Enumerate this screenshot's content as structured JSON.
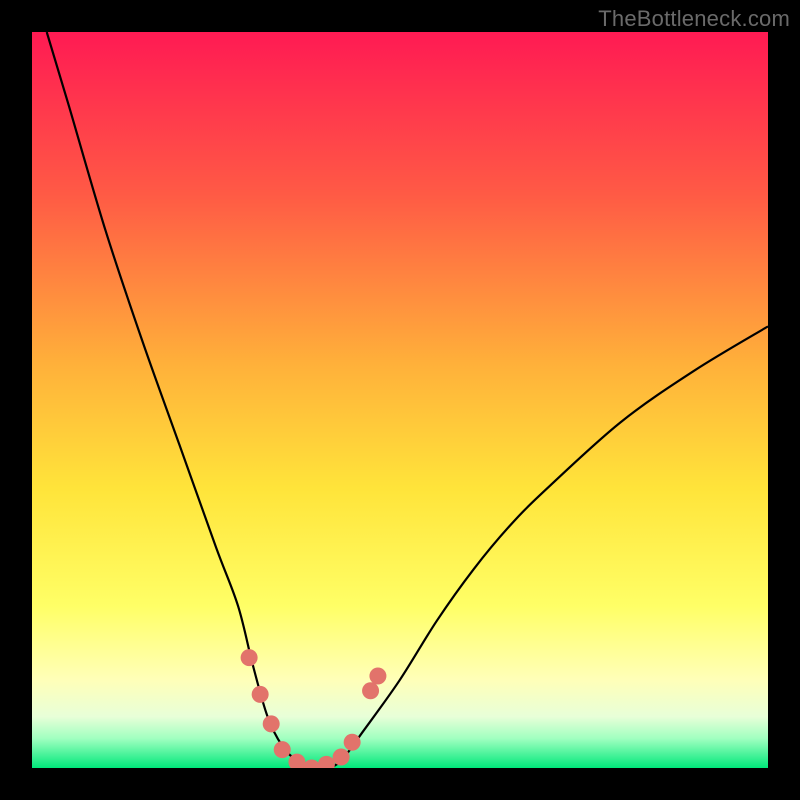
{
  "watermark": "TheBottleneck.com",
  "colors": {
    "frame": "#000000",
    "gradient_top": "#ff1a53",
    "gradient_mid1": "#ff7a3a",
    "gradient_mid2": "#ffd43a",
    "gradient_mid3": "#ffff66",
    "gradient_pale": "#ffffd0",
    "gradient_bottom": "#00e87a",
    "curve": "#000000",
    "marker": "#e2736b"
  },
  "chart_data": {
    "type": "line",
    "title": "",
    "xlabel": "",
    "ylabel": "",
    "xlim": [
      0,
      100
    ],
    "ylim": [
      0,
      100
    ],
    "grid": false,
    "legend": false,
    "series": [
      {
        "name": "bottleneck-curve",
        "x": [
          2,
          5,
          10,
          15,
          20,
          25,
          28,
          30,
          32,
          34,
          36,
          38,
          40,
          42,
          45,
          50,
          55,
          60,
          65,
          70,
          80,
          90,
          100
        ],
        "y": [
          100,
          90,
          73,
          58,
          44,
          30,
          22,
          14,
          7,
          3,
          1,
          0,
          0,
          1,
          5,
          12,
          20,
          27,
          33,
          38,
          47,
          54,
          60
        ]
      }
    ],
    "markers": {
      "name": "highlight-dots",
      "x": [
        29.5,
        31.0,
        32.5,
        34.0,
        36.0,
        38.0,
        40.0,
        42.0,
        43.5,
        46.0,
        47.0
      ],
      "y": [
        15.0,
        10.0,
        6.0,
        2.5,
        0.8,
        0.0,
        0.5,
        1.5,
        3.5,
        10.5,
        12.5
      ]
    }
  }
}
